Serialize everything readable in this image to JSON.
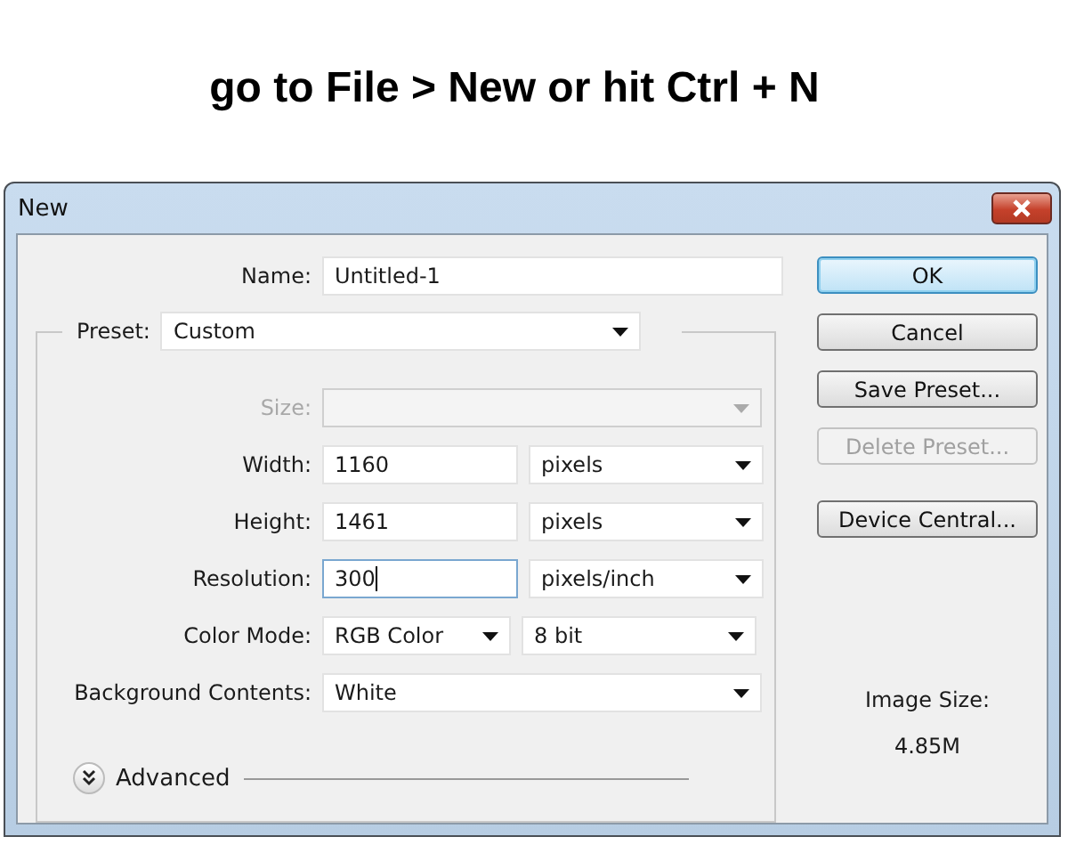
{
  "caption": "go to File > New or hit Ctrl + N",
  "window": {
    "title": "New"
  },
  "name": {
    "label": "Name:",
    "value": "Untitled-1"
  },
  "preset": {
    "label": "Preset:",
    "value": "Custom"
  },
  "rows": [
    {
      "kind": "wide-select",
      "label": "Size:",
      "disabled": true,
      "focused": false
    },
    {
      "kind": "input",
      "label": "Width:",
      "value": "1160",
      "unit": "pixels",
      "disabled": false,
      "focused": false
    },
    {
      "kind": "input",
      "label": "Height:",
      "value": "1461",
      "unit": "pixels",
      "disabled": false,
      "focused": false
    },
    {
      "kind": "input",
      "label": "Resolution:",
      "value": "300",
      "unit": "pixels/inch",
      "disabled": false,
      "focused": true
    },
    {
      "kind": "select",
      "label": "Color Mode:",
      "value": "RGB Color",
      "unit": "8 bit",
      "disabled": false,
      "focused": false
    },
    {
      "kind": "wide-select",
      "label": "Background Contents:",
      "value": "White",
      "disabled": false,
      "focused": false
    }
  ],
  "advanced": {
    "label": "Advanced",
    "expanded": false
  },
  "buttons": [
    {
      "label": "OK",
      "default": true,
      "disabled": false
    },
    {
      "label": "Cancel",
      "default": false,
      "disabled": false
    },
    {
      "label": "Save Preset...",
      "default": false,
      "disabled": false
    },
    {
      "label": "Delete Preset...",
      "default": false,
      "disabled": true
    }
  ],
  "more_buttons": [
    {
      "label": "Device Central...",
      "default": false,
      "disabled": false
    }
  ],
  "image_size": {
    "label": "Image Size:",
    "value": "4.85M"
  }
}
